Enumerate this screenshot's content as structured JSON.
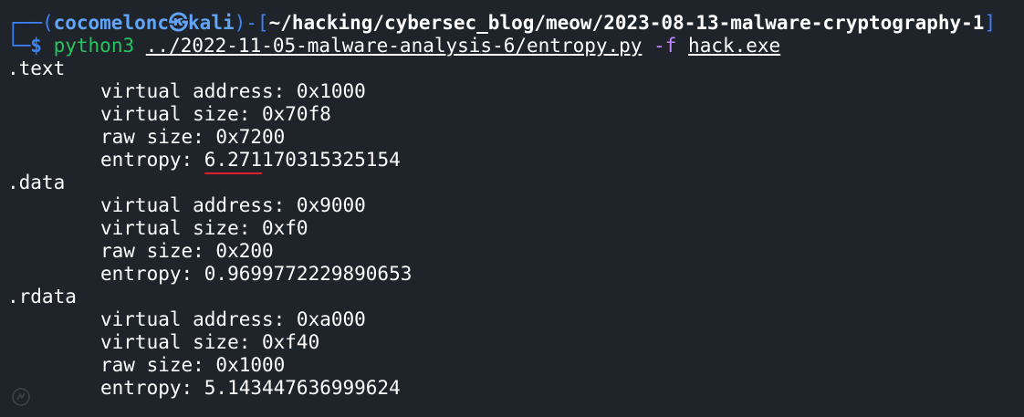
{
  "prompt": {
    "tree_top": "┌──",
    "tree_bottom": "└─",
    "paren_open": "(",
    "user": "cocomelonc",
    "at": "㉿",
    "host": "kali",
    "paren_close": ")",
    "sep_open": "-[",
    "path": "~/hacking/cybersec_blog/meow/2023-08-13-malware-cryptography-1",
    "sep_close": "]",
    "dollar": "$",
    "command": "python3",
    "script": "../2022-11-05-malware-analysis-6/entropy.py",
    "flag": "-f",
    "file": "hack.exe"
  },
  "sections": [
    {
      "name": ".text",
      "virtual_address": "virtual address: 0x1000",
      "virtual_size": "virtual size: 0x70f8",
      "raw_size": "raw size: 0x7200",
      "entropy_label": "entropy: ",
      "entropy_value_underlined": "6.271",
      "entropy_value_rest": "170315325154"
    },
    {
      "name": ".data",
      "virtual_address": "virtual address: 0x9000",
      "virtual_size": "virtual size: 0xf0",
      "raw_size": "raw size: 0x200",
      "entropy": "entropy: 0.9699772229890653"
    },
    {
      "name": ".rdata",
      "virtual_address": "virtual address: 0xa000",
      "virtual_size": "virtual size: 0xf40",
      "raw_size": "raw size: 0x1000",
      "entropy": "entropy: 5.143447636999624"
    }
  ],
  "colors": {
    "background": "#1f242b",
    "prompt_blue": "#3b82f6",
    "command_green": "#22c55e",
    "flag_purple": "#c084fc",
    "highlight_red": "#e11d2e"
  }
}
